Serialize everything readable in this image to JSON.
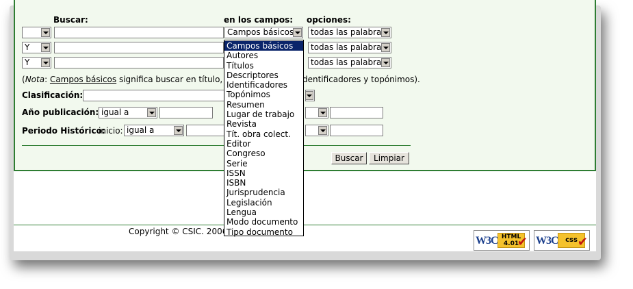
{
  "headers": {
    "buscar": "Buscar:",
    "campos": "en los campos:",
    "opciones": "opciones:"
  },
  "rows": [
    {
      "op": "",
      "field": "Campos básicos",
      "option": "todas las palabras"
    },
    {
      "op": "Y",
      "field": "",
      "option": "todas las palabras"
    },
    {
      "op": "Y",
      "field": "",
      "option": "todas las palabras"
    }
  ],
  "note": {
    "prefix": "(",
    "italic": "Nota",
    "colon": ": ",
    "link": "Campos básicos",
    "middle": " significa buscar en título, res",
    "suffix": "dentificadores y topónimos)."
  },
  "clasificacion": {
    "label": "Clasificación:"
  },
  "anio": {
    "label": "Año publicación:",
    "op": "igual a"
  },
  "periodo": {
    "label": "Periodo Histórico:",
    "inicio": "inicio:",
    "op": "igual a"
  },
  "buttons": {
    "buscar": "Buscar",
    "limpiar": "Limpiar"
  },
  "dropdown_options": [
    "Campos básicos",
    "Autores",
    "Títulos",
    "Descriptores",
    "Identificadores",
    "Topónimos",
    "Resumen",
    "Lugar de trabajo",
    "Revista",
    "Tít. obra colect.",
    "Editor",
    "Congreso",
    "Serie",
    "ISSN",
    "ISBN",
    "Jurisprudencia",
    "Legislación",
    "Lengua",
    "Modo documento",
    "Tipo documento"
  ],
  "dropdown_selected_index": 0,
  "footer": {
    "copyright": "Copyright © CSIC. 2006",
    "badge_html": {
      "w3c": "W3C",
      "line1": "HTML",
      "line2": "4.01"
    },
    "badge_css": {
      "w3c": "W3C",
      "line1": "css"
    }
  },
  "colors": {
    "panel_bg": "#f2f9ee",
    "border_green": "#2e7d32",
    "highlight": "#0a246a",
    "badge_yellow": "#f5c22c"
  }
}
